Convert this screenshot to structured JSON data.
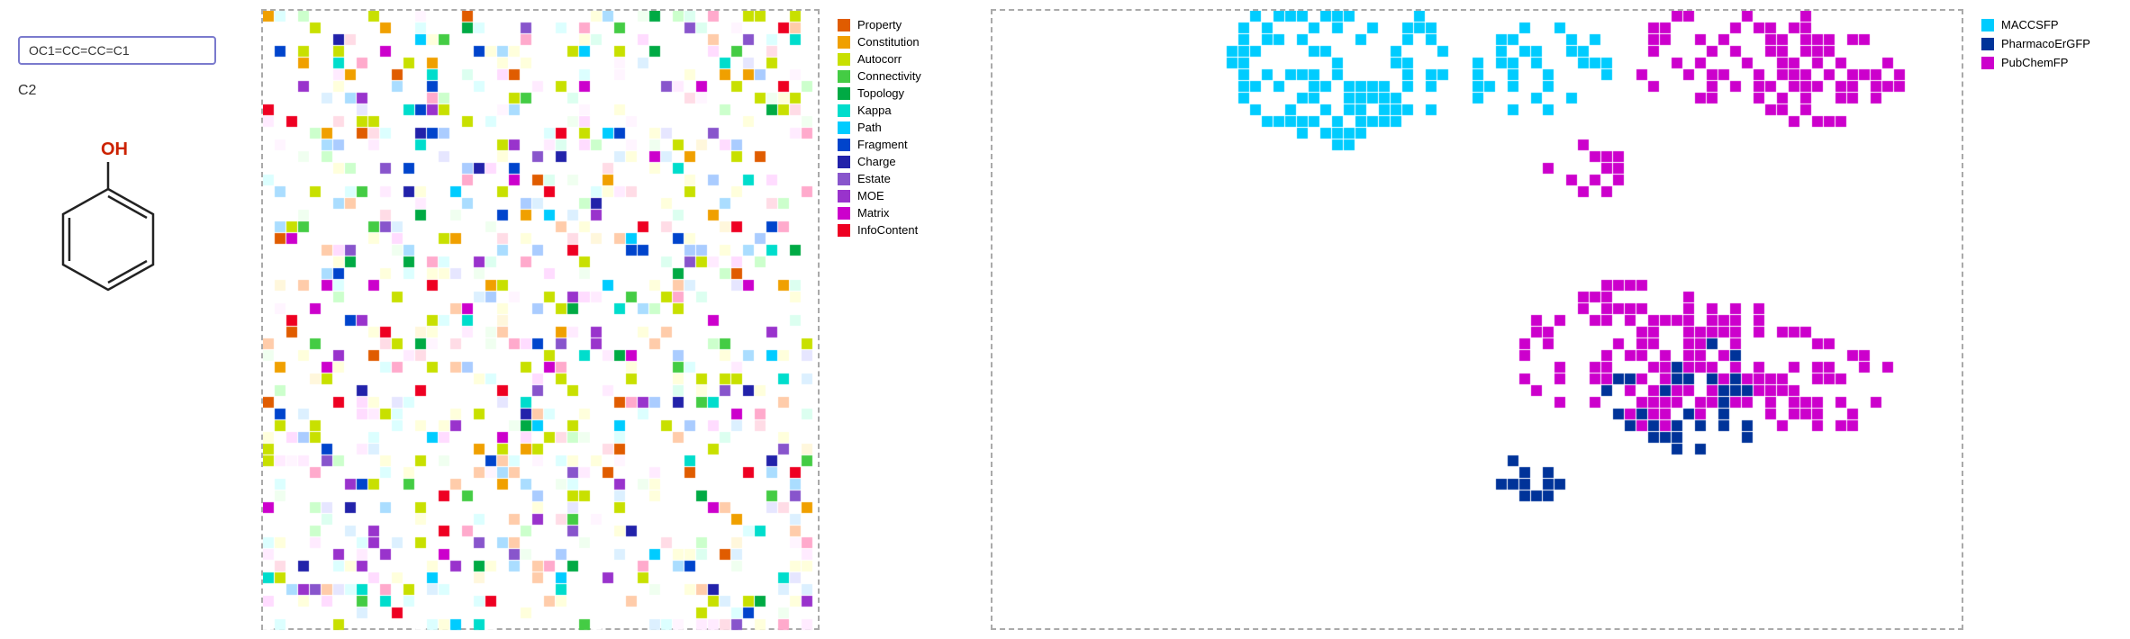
{
  "left": {
    "smiles": "OC1=CC=CC=C1",
    "mol_label": "C2"
  },
  "legend": {
    "items": [
      {
        "label": "Property",
        "color": "#e05c00"
      },
      {
        "label": "Constitution",
        "color": "#f0a000"
      },
      {
        "label": "Autocorr",
        "color": "#c8e000"
      },
      {
        "label": "Connectivity",
        "color": "#44cc44"
      },
      {
        "label": "Topology",
        "color": "#00aa44"
      },
      {
        "label": "Kappa",
        "color": "#00ddcc"
      },
      {
        "label": "Path",
        "color": "#00ccff"
      },
      {
        "label": "Fragment",
        "color": "#0044cc"
      },
      {
        "label": "Charge",
        "color": "#2222aa"
      },
      {
        "label": "Estate",
        "color": "#8855cc"
      },
      {
        "label": "MOE",
        "color": "#9933cc"
      },
      {
        "label": "Matrix",
        "color": "#cc00cc"
      },
      {
        "label": "InfoContent",
        "color": "#ee0022"
      }
    ]
  },
  "right_legend": {
    "items": [
      {
        "label": "MACCSFP",
        "color": "#00ccff"
      },
      {
        "label": "PharmacoErGFP",
        "color": "#003399"
      },
      {
        "label": "PubChemFP",
        "color": "#cc00cc"
      }
    ]
  }
}
